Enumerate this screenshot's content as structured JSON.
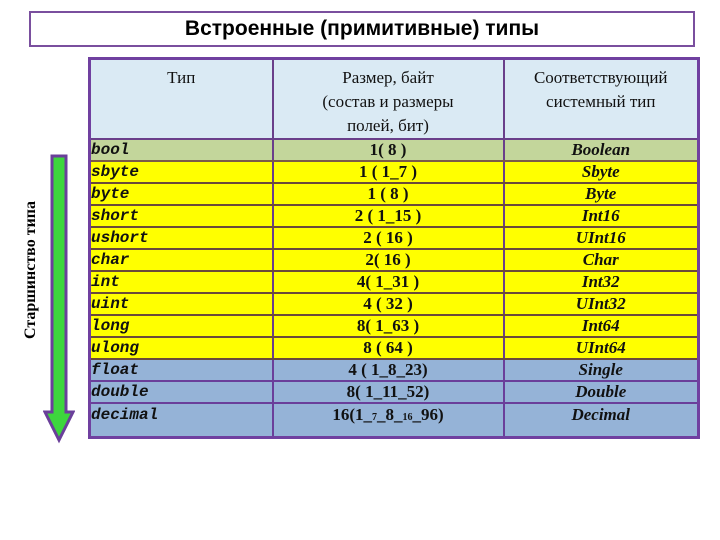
{
  "title": "Встроенные (примитивные) типы",
  "side_label": "Старшинство типа",
  "icons": {
    "arrow": "arrow-down-icon"
  },
  "colors": {
    "header_bg": "#daeaf4",
    "bool_row": "#c3d69b",
    "integer_rows": "#ffff00",
    "float_rows": "#95b3d7",
    "border": "#7040a0",
    "arrow_fill": "#3dd63d"
  },
  "table": {
    "headers": {
      "type": "Тип",
      "size_line1": "Размер, байт",
      "size_line2": "(состав и размеры",
      "size_line3": "полей, бит)",
      "system_line1": "Соответствующий",
      "system_line2": "системный тип"
    },
    "rows": [
      {
        "type": "bool",
        "size": "1( 8 )",
        "system": "Boolean",
        "group": "green"
      },
      {
        "type": "sbyte",
        "size": "1 ( 1_7 )",
        "system": "Sbyte",
        "group": "yellow"
      },
      {
        "type": "byte",
        "size": "1 ( 8 )",
        "system": "Byte",
        "group": "yellow"
      },
      {
        "type": "short",
        "size": "2 ( 1_15 )",
        "system": "Int16",
        "group": "yellow"
      },
      {
        "type": "ushort",
        "size": "2 ( 16 )",
        "system": "UInt16",
        "group": "yellow"
      },
      {
        "type": "char",
        "size": "2( 16 )",
        "system": "Char",
        "group": "yellow"
      },
      {
        "type": "int",
        "size": "4( 1_31 )",
        "system": "Int32",
        "group": "yellow"
      },
      {
        "type": "uint",
        "size": "4 ( 32 )",
        "system": "UInt32",
        "group": "yellow"
      },
      {
        "type": "long",
        "size": "8( 1_63 )",
        "system": "Int64",
        "group": "yellow"
      },
      {
        "type": "ulong",
        "size": "8 ( 64 )",
        "system": "UInt64",
        "group": "yellow"
      },
      {
        "type": "float",
        "size": "4 ( 1_8_23)",
        "system": "Single",
        "group": "blue"
      },
      {
        "type": "double",
        "size": "8( 1_11_52)",
        "system": "Double",
        "group": "blue"
      },
      {
        "type": "decimal",
        "size_parts": {
          "a": "16(1_",
          "b": "7",
          "c": "_8_",
          "d": "16",
          "e": "_96)"
        },
        "system": "Decimal",
        "group": "blue"
      }
    ]
  }
}
